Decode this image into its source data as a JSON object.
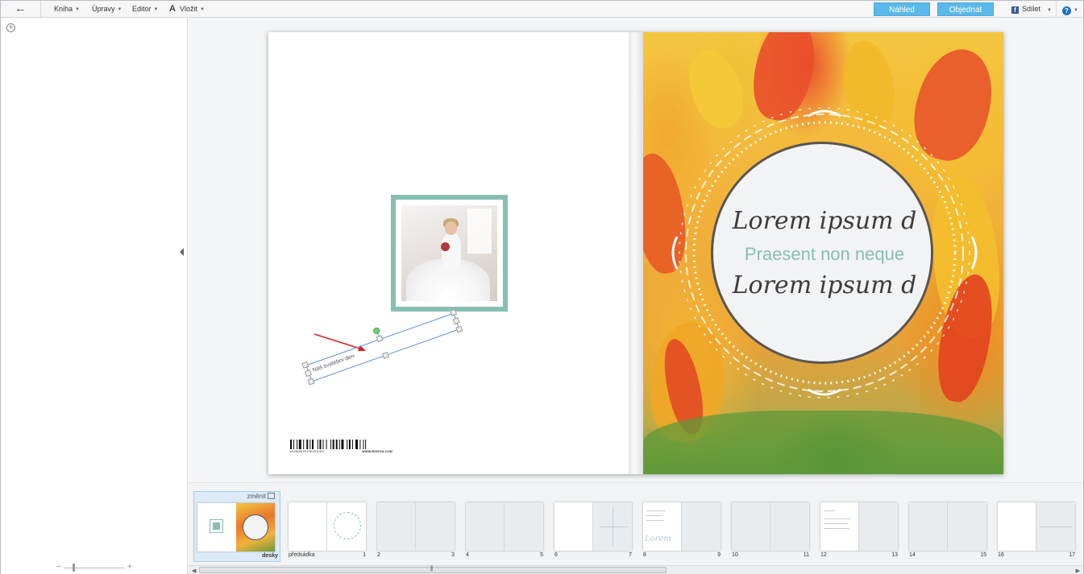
{
  "toolbar": {
    "back_icon": "arrow-left-icon",
    "menus": [
      {
        "label": "Kniha"
      },
      {
        "label": "Úpravy"
      },
      {
        "label": "Editor"
      },
      {
        "label": "Vložit",
        "icon": "text-a-icon",
        "icon_glyph": "A"
      }
    ],
    "preview_label": "Náhled",
    "order_label": "Objednat",
    "share_label": "Sdílet",
    "share_icon": "facebook-icon",
    "help_icon": "help-icon",
    "help_glyph": "?",
    "accent_color": "#5ab9ea"
  },
  "left_panel": {
    "add_icon": "add-circle-icon",
    "zoom_minus": "−",
    "zoom_plus": "+"
  },
  "book": {
    "back_cover": {
      "text_box": "Náš svatební den",
      "barcode_number": "0128GMTECNU201337",
      "barcode_site": "WWW.BONTIA.COM",
      "photo_frame_color": "#86bfb1"
    },
    "front_cover": {
      "line1": "Lorem ipsum d",
      "line2": "Praesent non neque",
      "line3": "Lorem ipsum d",
      "accent_color": "#86bfb1"
    }
  },
  "thumbnails": {
    "change_label": "změnit",
    "items": [
      {
        "left": "",
        "right": "desky",
        "active": true
      },
      {
        "left": "předsádka",
        "right": "1"
      },
      {
        "left": "2",
        "right": "3"
      },
      {
        "left": "4",
        "right": "5"
      },
      {
        "left": "6",
        "right": "7"
      },
      {
        "left": "8",
        "right": "9"
      },
      {
        "left": "10",
        "right": "11"
      },
      {
        "left": "12",
        "right": "13"
      },
      {
        "left": "14",
        "right": "15"
      },
      {
        "left": "16",
        "right": "17"
      }
    ],
    "mini_lorem": "Lorem"
  },
  "scrollbar": {
    "grip": "|||"
  }
}
